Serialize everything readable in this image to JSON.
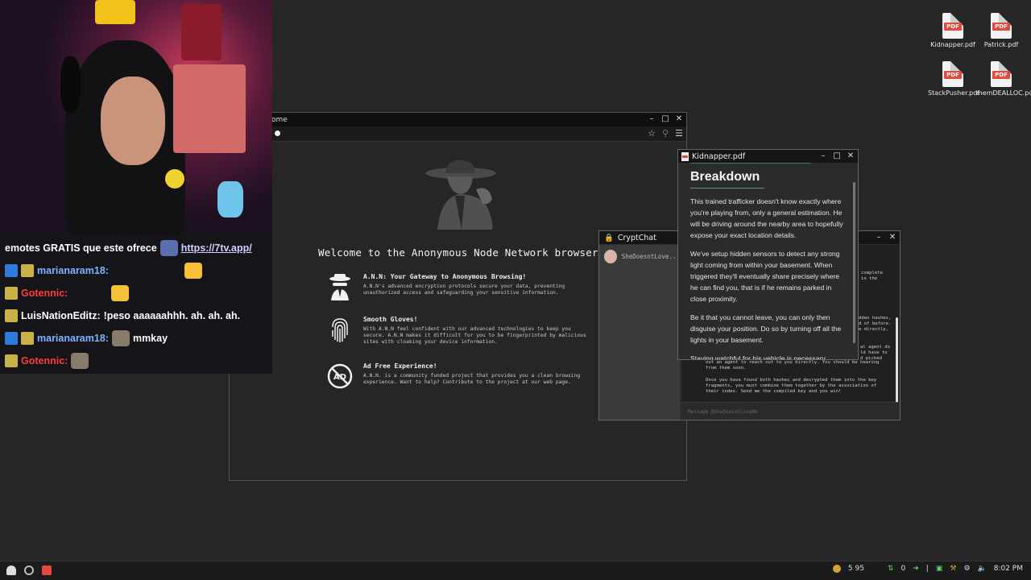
{
  "desktop": {
    "icons": [
      {
        "label": "Kidnapper.pdf",
        "tag": "PDF"
      },
      {
        "label": "Patrick.pdf",
        "tag": "PDF"
      },
      {
        "label": "StackPusher.pdf",
        "tag": "PDF"
      },
      {
        "label": "memDEALLOC.pdf",
        "tag": "PDF"
      }
    ]
  },
  "stream_chat": {
    "header_text": "emotes GRATIS que este ofrece",
    "header_link": "https://7tv.app/",
    "lines": [
      {
        "user": "marianaram18:",
        "message": "",
        "user_color": "#7fb3ff"
      },
      {
        "user": "Gotennic:",
        "message": "",
        "user_color": "#ff3b3b"
      },
      {
        "user": "LuisNationEditz:",
        "message": "!peso aaaaaahhh. ah. ah. ah.",
        "user_color": "#ffffff"
      },
      {
        "user": "marianaram18:",
        "message": "mmkay",
        "user_color": "#7fb3ff"
      },
      {
        "user": "Gotennic:",
        "message": "",
        "user_color": "#ff3b3b"
      }
    ]
  },
  "browser": {
    "title": "ome",
    "welcome": "Welcome to the Anonymous Node Network browser!",
    "features": [
      {
        "title": "A.N.N: Your Gateway to Anonymous Browsing!",
        "desc": "A.N.N's advanced encryption protocols secure your data, preventing unauthorized access and safeguarding your sensitive information.",
        "icon": "spy-icon"
      },
      {
        "title": "Smooth Gloves!",
        "desc": "With A.N.N feel confident with our advanced technologies to keep you secure. A.N.N makes it difficult for you to be fingerprinted by malicious sites with cloaking your device information.",
        "icon": "fingerprint-icon"
      },
      {
        "title": "Ad Free Experience!",
        "desc": "A.N.N. is a community funded project that provides you a clean browsing experience. Want to help? Contribute to the project at our web page.",
        "icon": "no-ads-icon"
      }
    ]
  },
  "cryptchat": {
    "title": "CryptChat",
    "contact": "SheDoesntLove...",
    "fragments_top": [
      "complete",
      "in the"
    ],
    "fragments_mid": [
      "dden hashes,",
      "d of before.",
      "e directly,"
    ],
    "fragments_mid2": [
      "al agent do",
      "ld have to",
      "d picked"
    ],
    "visible_message_1": "out an agent to reach out to you directly. You should be hearing from them soon.",
    "visible_message_2": "Once you have found both hashes and decrypted them into the key fragments, you must combine them together by the association of their index. Send me the compiled key and you win!",
    "input_placeholder": "Message @SheDoesntLoveMe"
  },
  "pdf": {
    "title": "Kidnapper.pdf",
    "heading": "Breakdown",
    "paragraphs": [
      "This trained trafficker doesn't know exactly where you're playing from, only a general estimation. He will be driving around the nearby area to hopefully expose your exact location details.",
      "We've setup hidden sensors to detect any strong light coming from within your basement. When triggered they'll eventually share precisely where he can find you, that is if he remains parked in close proximity.",
      "Be it that you cannot leave, you can only then disguise your position. Do so by turning off all the lights in your basement.",
      "Staying watchful for his vehicle is necessary"
    ]
  },
  "taskbar": {
    "coins": "5 95",
    "net_count": "0",
    "time": "8:02 PM"
  }
}
